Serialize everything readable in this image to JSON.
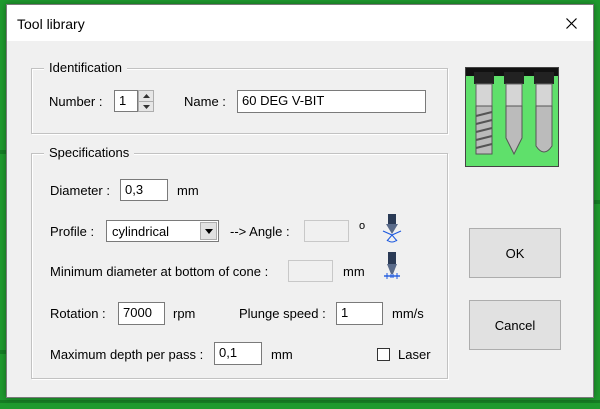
{
  "window": {
    "title": "Tool library"
  },
  "identification": {
    "legend": "Identification",
    "number_label": "Number :",
    "number_value": "1",
    "name_label": "Name :",
    "name_value": "60 DEG V-BIT"
  },
  "specifications": {
    "legend": "Specifications",
    "diameter_label": "Diameter :",
    "diameter_value": "0,3",
    "diameter_unit": "mm",
    "profile_label": "Profile :",
    "profile_value": "cylindrical",
    "angle_label": "--> Angle :",
    "angle_value": "",
    "angle_unit": "o",
    "min_diameter_label": "Minimum diameter at bottom of cone :",
    "min_diameter_value": "",
    "min_diameter_unit": "mm",
    "rotation_label": "Rotation :",
    "rotation_value": "7000",
    "rotation_unit": "rpm",
    "plunge_label": "Plunge speed :",
    "plunge_value": "1",
    "plunge_unit": "mm/s",
    "depth_label": "Maximum depth per pass :",
    "depth_value": "0,1",
    "depth_unit": "mm",
    "laser_label": "Laser",
    "laser_checked": false
  },
  "buttons": {
    "ok": "OK",
    "cancel": "Cancel"
  },
  "icons": {
    "close": "close-icon",
    "tool_image": "tool-bits-icon",
    "angle": "cone-angle-icon",
    "min_diameter": "cone-tip-diameter-icon"
  }
}
